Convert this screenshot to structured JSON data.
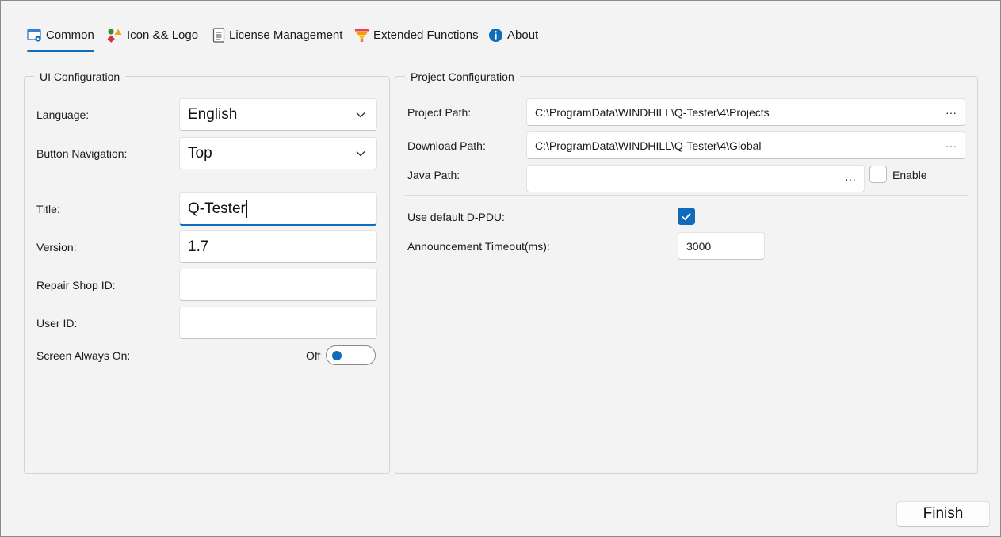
{
  "tabs": [
    {
      "label": "Common",
      "icon": "window-gear-icon",
      "active": true
    },
    {
      "label": "Icon && Logo",
      "icon": "shapes-icon",
      "active": false
    },
    {
      "label": "License Management",
      "icon": "document-icon",
      "active": false
    },
    {
      "label": "Extended Functions",
      "icon": "funnel-icon",
      "active": false
    },
    {
      "label": "About",
      "icon": "info-icon",
      "active": false
    }
  ],
  "ui_config": {
    "title": "UI Configuration",
    "language_label": "Language:",
    "language_value": "English",
    "button_nav_label": "Button Navigation:",
    "button_nav_value": "Top",
    "title_label": "Title:",
    "title_value": "Q-Tester",
    "version_label": "Version:",
    "version_value": "1.7",
    "repair_shop_label": "Repair Shop ID:",
    "repair_shop_value": "",
    "user_id_label": "User ID:",
    "user_id_value": "",
    "screen_on_label": "Screen Always On:",
    "screen_on_state": "Off"
  },
  "project_config": {
    "title": "Project Configuration",
    "project_path_label": "Project Path:",
    "project_path_value": "C:\\ProgramData\\WINDHILL\\Q-Tester\\4\\Projects",
    "download_path_label": "Download Path:",
    "download_path_value": "C:\\ProgramData\\WINDHILL\\Q-Tester\\4\\Global",
    "java_path_label": "Java Path:",
    "java_path_value": "",
    "browse_label": "···",
    "enable_label": "Enable",
    "enable_checked": false,
    "default_dpdu_label": "Use default D-PDU:",
    "default_dpdu_checked": true,
    "timeout_label": "Announcement Timeout(ms):",
    "timeout_value": "3000"
  },
  "footer": {
    "finish_label": "Finish"
  },
  "colors": {
    "accent": "#0f6cbd",
    "background": "#f3f3f3"
  }
}
